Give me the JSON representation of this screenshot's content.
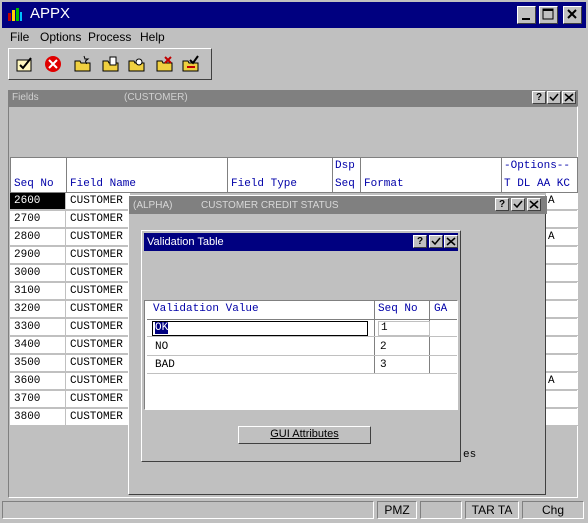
{
  "window": {
    "title": "APPX"
  },
  "menu": [
    "File",
    "Options",
    "Process",
    "Help"
  ],
  "fields_window": {
    "title": "Fields",
    "context": "(CUSTOMER)"
  },
  "grid": {
    "headers": {
      "seq_no": "Seq No",
      "field_name": "Field Name",
      "field_type": "Field Type",
      "dsp": "Dsp",
      "seq": "Seq",
      "format": "Format",
      "options": "-Options--",
      "opt_cols": "T DL AA KC"
    },
    "rows": [
      {
        "seq": "2600",
        "name": "CUSTOMER",
        "right": "A"
      },
      {
        "seq": "2700",
        "name": "CUSTOMER",
        "right": ""
      },
      {
        "seq": "2800",
        "name": "CUSTOMER",
        "right": "A"
      },
      {
        "seq": "2900",
        "name": "CUSTOMER",
        "right": ""
      },
      {
        "seq": "3000",
        "name": "CUSTOMER",
        "right": ""
      },
      {
        "seq": "3100",
        "name": "CUSTOMER",
        "right": ""
      },
      {
        "seq": "3200",
        "name": "CUSTOMER",
        "right": ""
      },
      {
        "seq": "3300",
        "name": "CUSTOMER",
        "right": ""
      },
      {
        "seq": "3400",
        "name": "CUSTOMER",
        "right": ""
      },
      {
        "seq": "3500",
        "name": "CUSTOMER",
        "right": ""
      },
      {
        "seq": "3600",
        "name": "CUSTOMER",
        "right": "A"
      },
      {
        "seq": "3700",
        "name": "CUSTOMER",
        "right": ""
      },
      {
        "seq": "3800",
        "name": "CUSTOMER",
        "right": ""
      }
    ]
  },
  "credit_window": {
    "type": "(ALPHA)",
    "title": "CUSTOMER CREDIT STATUS",
    "trailing_text": "es"
  },
  "validation": {
    "title": "Validation Table",
    "headers": {
      "value": "Validation Value",
      "seq": "Seq No",
      "ga": "GA"
    },
    "rows": [
      {
        "value": "OK",
        "seq": "1"
      },
      {
        "value": "NO",
        "seq": "2"
      },
      {
        "value": "BAD",
        "seq": "3"
      }
    ],
    "gui_button": "GUI Attributes"
  },
  "status": {
    "mode": "PMZ",
    "keys": "TAR TA",
    "action": "Chg"
  },
  "icons": {
    "title_buttons": [
      "minimize-icon",
      "maximize-icon",
      "close-icon"
    ],
    "child_buttons": [
      "help-icon",
      "ok-check-icon",
      "close-icon"
    ],
    "toolbar": [
      "ok-check-icon",
      "cancel-icon",
      "folder-new-icon",
      "folder-edit-icon",
      "folder-search-icon",
      "folder-delete-icon",
      "folder-check-icon"
    ]
  }
}
